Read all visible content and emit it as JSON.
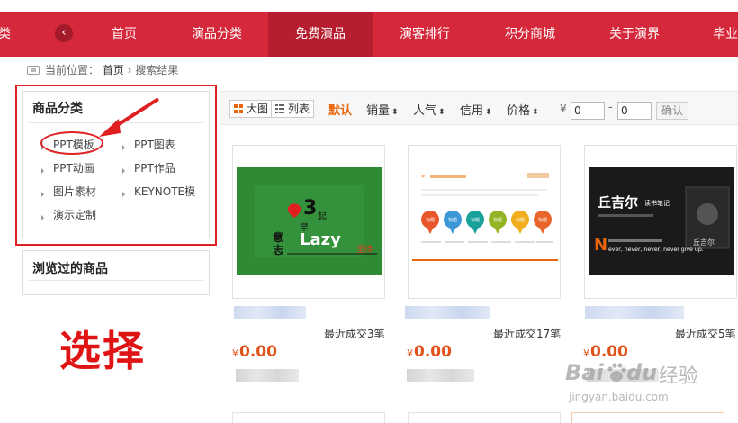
{
  "nav": {
    "items": [
      {
        "label": "类"
      },
      {
        "label": "首页"
      },
      {
        "label": "演品分类"
      },
      {
        "label": "免费演品"
      },
      {
        "label": "演客排行"
      },
      {
        "label": "积分商城"
      },
      {
        "label": "关于演界"
      },
      {
        "label": "毕业"
      }
    ],
    "prev_arrow": "‹",
    "active_index": 3
  },
  "breadcrumb": {
    "prefix": "当前位置：",
    "home": "首页",
    "sep": "›",
    "current": "搜索结果"
  },
  "category": {
    "title": "商品分类",
    "items": [
      "PPT模板",
      "PPT图表",
      "PPT动画",
      "PPT作品",
      "图片素材",
      "KEYNOTE模",
      "演示定制"
    ]
  },
  "browsed": {
    "title": "浏览过的商品"
  },
  "annotation": {
    "label": "选择"
  },
  "toolbar": {
    "view_grid": "大图",
    "view_list": "列表",
    "sorts": [
      "默认",
      "销量",
      "人气",
      "信用",
      "价格"
    ],
    "sort_caret": "⬍",
    "yen": "¥",
    "price_min": "0",
    "dash": "-",
    "price_max": "0",
    "confirm": "确认"
  },
  "products": [
    {
      "recent": "最近成交3笔",
      "price_symbol": "¥",
      "price": "0.00",
      "thumb": {
        "text1": "3",
        "text2": "起",
        "text3": "早",
        "text4": "意",
        "text5": "志",
        "text6": "Lazy",
        "text7": "坚持"
      }
    },
    {
      "recent": "最近成交17笔",
      "price_symbol": "¥",
      "price": "0.00",
      "thumb": {
        "tags": [
          "标题",
          "标题",
          "标题",
          "标题",
          "标题",
          "标题"
        ]
      }
    },
    {
      "recent": "最近成交5笔",
      "price_symbol": "¥",
      "price": "0.00",
      "thumb": {
        "title": "丘吉尔",
        "subtitle": "读书笔记",
        "book": "丘吉尔",
        "quote_initial": "N",
        "quote": "ever, never, never, never give up."
      }
    }
  ],
  "watermark": {
    "brand": "Bai",
    "brand2": "du",
    "site": "经验",
    "url": "jingyan.baidu.com"
  },
  "colors": {
    "nav": "#d6283b",
    "accent": "#e8650b",
    "price": "#e2531b",
    "highlight": "#e02020"
  }
}
